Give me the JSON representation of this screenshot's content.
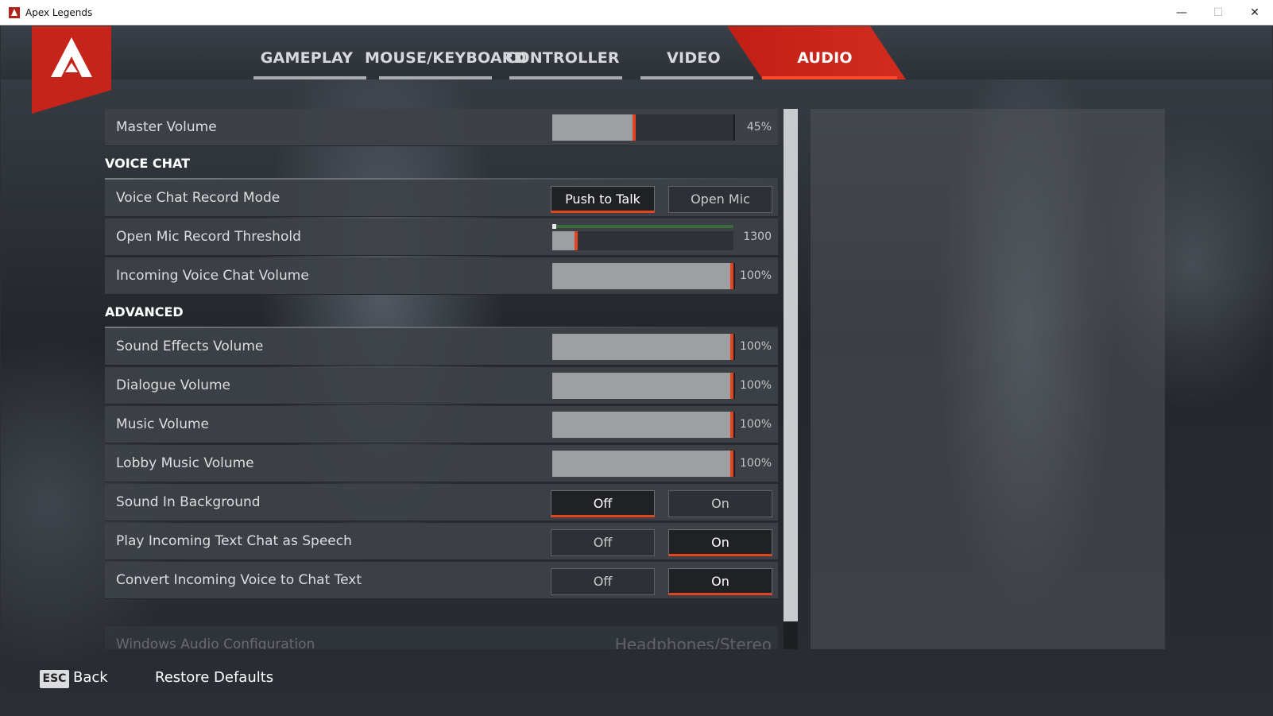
{
  "window": {
    "title": "Apex Legends",
    "minimize": "—",
    "maximize": "☐",
    "close": "✕"
  },
  "tabs": [
    {
      "label": "GAMEPLAY"
    },
    {
      "label": "MOUSE/KEYBOARD"
    },
    {
      "label": "CONTROLLER"
    },
    {
      "label": "VIDEO"
    },
    {
      "label": "AUDIO",
      "active": true
    }
  ],
  "master": {
    "label": "Master Volume",
    "value": "45%",
    "level": 0.45
  },
  "voice_chat": {
    "header": "VOICE CHAT",
    "record_mode": {
      "label": "Voice Chat Record Mode",
      "options": [
        "Push to Talk",
        "Open Mic"
      ],
      "selected": "Push to Talk"
    },
    "threshold": {
      "label": "Open Mic Record Threshold",
      "value": "1300",
      "level": 0.13
    },
    "incoming": {
      "label": "Incoming Voice Chat Volume",
      "value": "100%",
      "level": 1.0
    }
  },
  "advanced": {
    "header": "ADVANCED",
    "sfx": {
      "label": "Sound Effects Volume",
      "value": "100%",
      "level": 1.0
    },
    "dialogue": {
      "label": "Dialogue Volume",
      "value": "100%",
      "level": 1.0
    },
    "music": {
      "label": "Music Volume",
      "value": "100%",
      "level": 1.0
    },
    "lobby_music": {
      "label": "Lobby Music Volume",
      "value": "100%",
      "level": 1.0
    },
    "sound_bg": {
      "label": "Sound In Background",
      "off": "Off",
      "on": "On",
      "selected": "Off"
    },
    "text_to_speech": {
      "label": "Play Incoming Text Chat as Speech",
      "off": "Off",
      "on": "On",
      "selected": "On"
    },
    "voice_to_text": {
      "label": "Convert Incoming Voice to Chat Text",
      "off": "Off",
      "on": "On",
      "selected": "On"
    },
    "audio_config": {
      "label": "Windows Audio Configuration",
      "value": "Headphones/Stereo"
    }
  },
  "footer": {
    "esc": "ESC",
    "back": "Back",
    "restore": "Restore Defaults"
  },
  "colors": {
    "accent": "#e0451f",
    "brand_red": "#c4241a"
  }
}
